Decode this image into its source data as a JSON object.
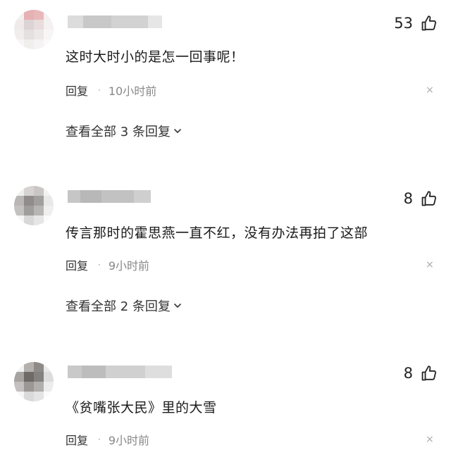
{
  "comments": [
    {
      "likes": "53",
      "text": "这时大时小的是怎一回事呢！",
      "reply_label": "回复",
      "separator": "·",
      "time": "10小时前",
      "view_replies": "查看全部 3 条回复",
      "close_glyph": "×"
    },
    {
      "likes": "8",
      "text": "传言那时的霍思燕一直不红，没有办法再拍了这部",
      "reply_label": "回复",
      "separator": "·",
      "time": "9小时前",
      "view_replies": "查看全部 2 条回复",
      "close_glyph": "×"
    },
    {
      "likes": "8",
      "text": "《贫嘴张大民》里的大雪",
      "reply_label": "回复",
      "separator": "·",
      "time": "9小时前",
      "close_glyph": "×"
    }
  ],
  "icons": {
    "like": "thumbs-up-icon",
    "expand": "chevron-down-icon",
    "close": "close-icon"
  },
  "colors": {
    "text": "#1a1a1a",
    "meta": "#888888",
    "background": "#ffffff"
  }
}
